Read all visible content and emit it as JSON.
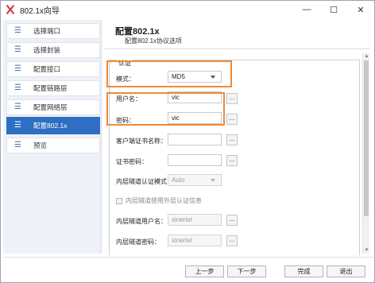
{
  "window": {
    "title": "802.1x向导",
    "minimize": "—",
    "maximize": "☐",
    "close": "✕"
  },
  "sidebar": {
    "items": [
      {
        "label": "选择端口",
        "icon": "list-icon",
        "active": false
      },
      {
        "label": "选择封装",
        "icon": "list-icon",
        "active": false
      },
      {
        "label": "配置接口",
        "icon": "list-icon",
        "active": false
      },
      {
        "label": "配置链路层",
        "icon": "list-icon",
        "active": false
      },
      {
        "label": "配置网络层",
        "icon": "list-icon",
        "active": false
      },
      {
        "label": "配置802.1x",
        "icon": "list-icon",
        "active": true
      },
      {
        "label": "预览",
        "icon": "list-icon",
        "active": false
      }
    ]
  },
  "header": {
    "title": "配置802.1x",
    "subtitle": "配置802.1x协议选项"
  },
  "auth_group": {
    "label": "认证"
  },
  "form": {
    "mode_label": "模式：",
    "mode_value": "MD5",
    "username_label": "用户名：",
    "username_value": "vic",
    "password_label": "密码：",
    "password_value": "vic",
    "client_cert_label": "客户端证书名称：",
    "client_cert_value": "",
    "cert_password_label": "证书密码：",
    "cert_password_value": "",
    "inner_mode_label": "内层隧道认证模式：",
    "inner_mode_value": "Auto",
    "use_outer_label": "内层隧道使用外层认证信息",
    "inner_user_label": "内层隧道用户名：",
    "inner_user_value": "xinertel",
    "inner_pass_label": "内层隧道密码：",
    "inner_pass_value": "xinertel",
    "browse_label": "..."
  },
  "footer": {
    "prev": "上一步",
    "next": "下一步",
    "finish": "完成",
    "exit": "退出"
  },
  "colors": {
    "accent": "#2f6fc3",
    "highlight": "#f08a36"
  }
}
